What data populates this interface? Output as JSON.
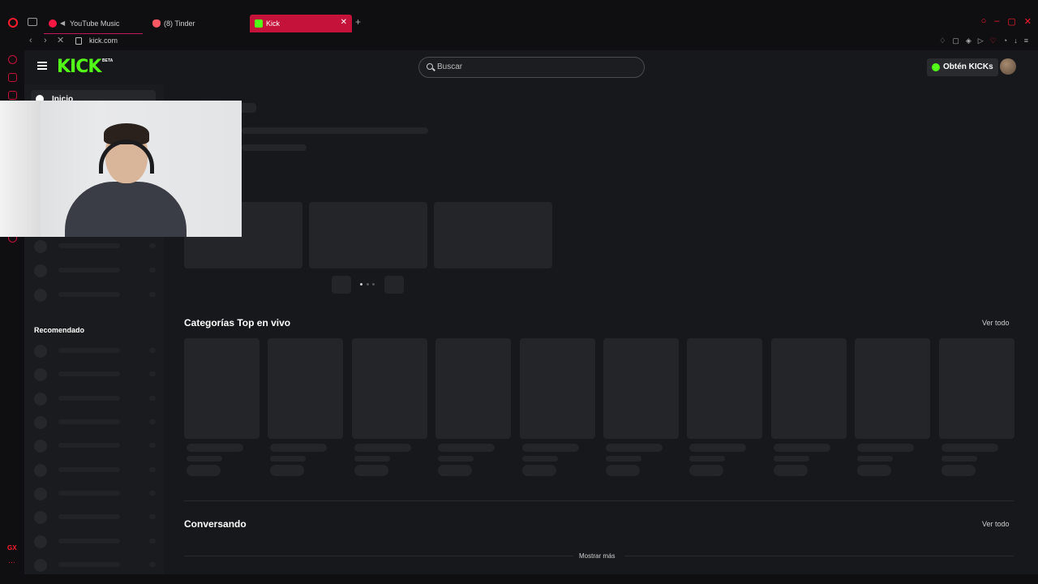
{
  "browser": {
    "tabs": [
      {
        "label": "YouTube Music"
      },
      {
        "label": "(8) Tinder"
      },
      {
        "label": "Kick"
      }
    ],
    "new_tab_label": "+",
    "close_tab_label": "✕",
    "url": "kick.com"
  },
  "header": {
    "logo": "KICK",
    "logo_badge": "BETA",
    "search_placeholder": "Buscar",
    "get_kicks_label": "Obtén KICKs"
  },
  "sidebar": {
    "home_label": "Inicio",
    "recommended_title": "Recomendado"
  },
  "main": {
    "top_categories_title": "Categorías Top en vivo",
    "top_categories_see_all": "Ver todo",
    "chatting_title": "Conversando",
    "chatting_see_all": "Ver todo",
    "show_more": "Mostrar más"
  },
  "colors": {
    "kick_green": "#53fc18",
    "opera_red": "#ff1b2d",
    "active_tab": "#c4123a",
    "page_bg": "#17181b"
  }
}
